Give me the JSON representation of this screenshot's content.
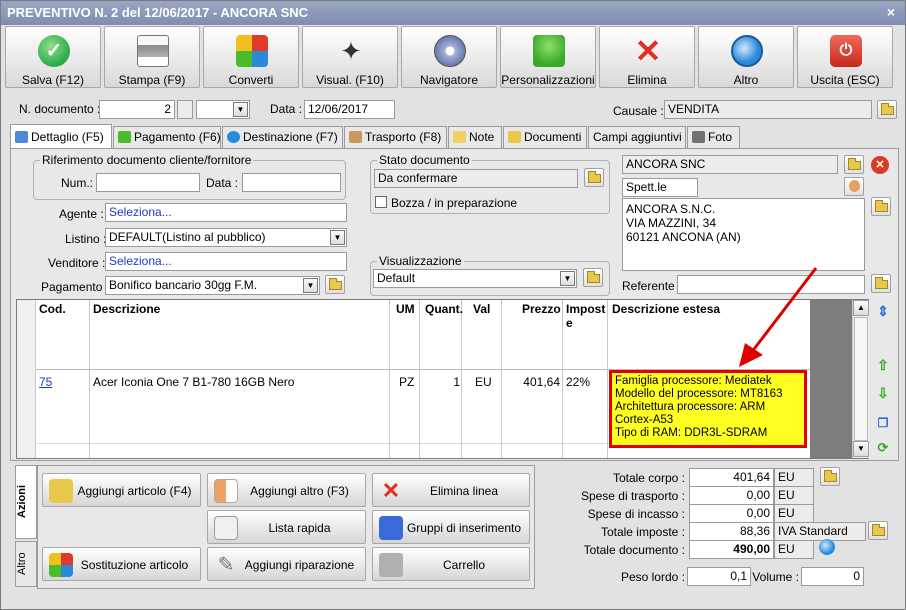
{
  "window": {
    "title": "PREVENTIVO N. 2 del 12/06/2017 - ANCORA SNC",
    "close": "×"
  },
  "toolbar": {
    "buttons": [
      {
        "label": "Salva (F12)",
        "icon": "check-icon",
        "color": "#2aa84a"
      },
      {
        "label": "Stampa (F9)",
        "icon": "printer-icon",
        "color": "#9a9a9a"
      },
      {
        "label": "Converti",
        "icon": "convert-icon",
        "color": "#3a7ad8"
      },
      {
        "label": "Visual. (F10)",
        "icon": "magic-wand-icon",
        "color": "#333333"
      },
      {
        "label": "Navigatore",
        "icon": "compass-icon",
        "color": "#7a8ab8"
      },
      {
        "label": "Personalizzazioni",
        "icon": "puzzle-icon",
        "color": "#4cbb2a"
      },
      {
        "label": "Elimina",
        "icon": "delete-x-icon",
        "color": "#e03020"
      },
      {
        "label": "Altro",
        "icon": "magnifier-icon",
        "color": "#2a8ad8"
      },
      {
        "label": "Uscita (ESC)",
        "icon": "power-icon",
        "color": "#d83a2a"
      }
    ]
  },
  "header": {
    "ndoc_label": "N. documento :",
    "ndoc_value": "2",
    "data_label": "Data :",
    "data_value": "12/06/2017",
    "causale_label": "Causale :",
    "causale_value": "VENDITA"
  },
  "tabs": [
    "Dettaglio (F5)",
    "Pagamento (F6)",
    "Destinazione (F7)",
    "Trasporto (F8)",
    "Note",
    "Documenti",
    "Campi aggiuntivi",
    "Foto"
  ],
  "riferimento": {
    "title": "Riferimento documento cliente/fornitore",
    "num_label": "Num.:",
    "data_label": "Data :"
  },
  "stato": {
    "title": "Stato documento",
    "value": "Da confermare",
    "bozza_label": "Bozza / in preparazione"
  },
  "visualizzazione": {
    "title": "Visualizzazione",
    "value": "Default"
  },
  "fields": {
    "agente_label": "Agente :",
    "agente_value": "Seleziona...",
    "listino_label": "Listino :",
    "listino_value": "DEFAULT(Listino al pubblico)",
    "venditore_label": "Venditore :",
    "venditore_value": "Seleziona...",
    "pagamento_label": "Pagamento :",
    "pagamento_value": "Bonifico bancario 30gg F.M."
  },
  "cliente": {
    "name": "ANCORA SNC",
    "short": "Spett.le",
    "address": [
      "ANCORA S.N.C.",
      "VIA MAZZINI, 34",
      "60121 ANCONA (AN)"
    ],
    "referente_label": "Referente"
  },
  "grid": {
    "headers": [
      "Cod.",
      "Descrizione",
      "UM",
      "Quant.",
      "Val",
      "Prezzo",
      "Impost e",
      "Descrizione estesa"
    ],
    "row": {
      "cod": "75",
      "descrizione": "Acer Iconia One 7 B1-780 16GB Nero",
      "um": "PZ",
      "quant": "1",
      "val": "EU",
      "prezzo": "401,64",
      "imposte": "22%"
    },
    "estesa": [
      "Famiglia processore: Mediatek",
      "Modello del processore: MT8163",
      "Architettura processore: ARM",
      "Cortex-A53",
      "Tipo di RAM: DDR3L-SDRAM"
    ]
  },
  "actions": {
    "tab_azioni": "Azioni",
    "tab_altro": "Altro",
    "buttons": [
      {
        "label": "Aggiungi articolo (F4)",
        "icon": "add-article-icon"
      },
      {
        "label": "Aggiungi altro (F3)",
        "icon": "add-other-icon"
      },
      {
        "label": "Elimina linea",
        "icon": "delete-line-icon"
      },
      {
        "label": "Lista rapida",
        "icon": "quick-list-icon"
      },
      {
        "label": "Gruppi di inserimento",
        "icon": "groups-icon"
      },
      {
        "label": "Sostituzione articolo",
        "icon": "replace-article-icon"
      },
      {
        "label": "Aggiungi riparazione",
        "icon": "wrench-icon"
      },
      {
        "label": "Carrello",
        "icon": "cart-icon"
      }
    ]
  },
  "totals": {
    "rows": [
      {
        "label": "Totale corpo :",
        "value": "401,64",
        "unit": "EU"
      },
      {
        "label": "Spese di trasporto :",
        "value": "0,00",
        "unit": "EU"
      },
      {
        "label": "Spese di incasso :",
        "value": "0,00",
        "unit": "EU"
      },
      {
        "label": "Totale imposte :",
        "value": "88,36",
        "unit": "IVA Standard"
      },
      {
        "label": "Totale documento :",
        "value": "490,00",
        "unit": "EU"
      }
    ],
    "peso_label": "Peso lordo :",
    "peso_value": "0,1",
    "volume_label": "Volume :",
    "volume_value": "0"
  }
}
